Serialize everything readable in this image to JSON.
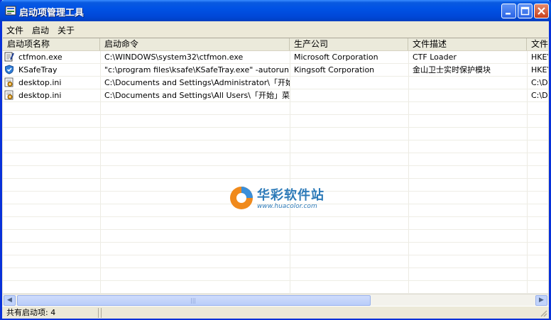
{
  "window": {
    "title": "启动项管理工具"
  },
  "menu": [
    "文件",
    "启动",
    "关于"
  ],
  "columns": [
    "启动项名称",
    "启动命令",
    "生产公司",
    "文件描述",
    "文件/"
  ],
  "rows": [
    {
      "icon": "notepad-icon",
      "name": "ctfmon.exe",
      "command": "C:\\WINDOWS\\system32\\ctfmon.exe",
      "company": "Microsoft Corporation",
      "description": "CTF Loader",
      "location": "HKEY_"
    },
    {
      "icon": "shield-icon",
      "name": "KSafeTray",
      "command": "\"c:\\program files\\ksafe\\KSafeTray.exe\" -autorun",
      "company": "Kingsoft Corporation",
      "description": "金山卫士实时保护模块",
      "location": "HKEY_"
    },
    {
      "icon": "settings-file-icon",
      "name": "desktop.ini",
      "command": "C:\\Documents and Settings\\Administrator\\「开始」...",
      "company": "",
      "description": "",
      "location": "C:\\Do"
    },
    {
      "icon": "settings-file-icon",
      "name": "desktop.ini",
      "command": "C:\\Documents and Settings\\All Users\\「开始」菜...",
      "company": "",
      "description": "",
      "location": "C:\\Do"
    }
  ],
  "status": {
    "count_label": "共有启动项: 4"
  },
  "watermark": {
    "title": "华彩软件站",
    "url": "www.huacolor.com"
  },
  "colors": {
    "titlebar": "#0052e5",
    "accent": "#2d7ab8"
  }
}
